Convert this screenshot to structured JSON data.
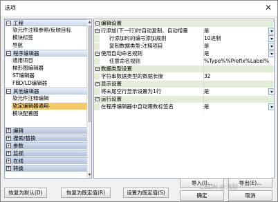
{
  "window": {
    "title": "选项",
    "close_icon": "close-icon"
  },
  "sidebar": {
    "groups_top": [
      {
        "label": "工程",
        "items": [
          "软元件注释参照/反映目标",
          "模块标签",
          "导航"
        ]
      },
      {
        "label": "程序编辑器",
        "items": [
          "通用项目",
          "梯形图编辑器",
          "ST编辑器",
          "FBD/LD编辑器"
        ]
      },
      {
        "label": "其他编辑器",
        "items": [
          "软元件注释编辑",
          "软定编辑器通用",
          "模块配置图"
        ],
        "selected": "软定编辑器通用"
      }
    ],
    "groups_bottom": [
      "编辑",
      "搜索/替换",
      "参数",
      "监视",
      "在线",
      "转换"
    ]
  },
  "grid": {
    "rows": [
      {
        "kind": "cat",
        "label": "编辑设置"
      },
      {
        "kind": "cat",
        "label": "行添加(下一行)时自动复制、自动增量",
        "value": "是",
        "dropdown": true
      },
      {
        "kind": "sub",
        "label": "行添加时的编号添加规则",
        "value": "10进制",
        "dropdown": true
      },
      {
        "kind": "sub",
        "label": "复制数据类型:注释项目",
        "value": "是",
        "dropdown": true
      },
      {
        "kind": "cat",
        "label": "使用自动命名规则",
        "value": "是",
        "dropdown": true
      },
      {
        "kind": "sub",
        "label": "任意命名规则",
        "value": "%Type%%Prefix%Label%%Num%",
        "dropdown": false
      },
      {
        "kind": "cat",
        "label": "数据类型设置"
      },
      {
        "kind": "prop",
        "label": "字符串数据类型的数据长度",
        "value": "32",
        "dropdown": false
      },
      {
        "kind": "cat",
        "label": "显示设置"
      },
      {
        "kind": "prop",
        "label": "将未尾空行显示设置为1行",
        "value": "是",
        "dropdown": true
      },
      {
        "kind": "cat",
        "label": "运行设置"
      },
      {
        "kind": "prop",
        "label": "在程序编辑器中自动跟数标签名",
        "value": "是",
        "dropdown": true
      }
    ]
  },
  "buttons": {
    "import": "导入(I)...",
    "export": "导出(E)...",
    "restore_default": "恢复为默认(D)",
    "restore_preset": "恢复为既定值(R)",
    "set_preset": "设置为既定值(S)",
    "ok": "确定",
    "cancel": "取消"
  },
  "watermark": "CSDN @浩钞"
}
